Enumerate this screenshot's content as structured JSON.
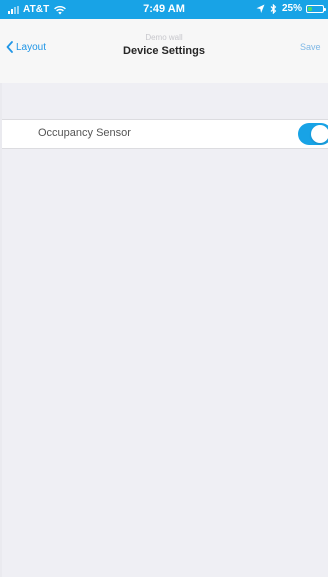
{
  "status_bar": {
    "carrier": "AT&T",
    "time": "7:49 AM",
    "battery_percent": "25%",
    "battery_level": 0.25
  },
  "nav": {
    "back_label": "Layout",
    "subtitle": "Demo wall",
    "title": "Device Settings",
    "save_label": "Save"
  },
  "settings": [
    {
      "label": "Occupancy Sensor",
      "enabled": true
    }
  ],
  "colors": {
    "accent": "#18a3e6",
    "link": "#2196e6",
    "background": "#efeff4"
  },
  "icons": {
    "signal": "signal-icon",
    "wifi": "wifi-icon",
    "location": "location-arrow-icon",
    "bluetooth": "bluetooth-icon",
    "battery": "battery-icon",
    "back": "chevron-left-icon"
  }
}
